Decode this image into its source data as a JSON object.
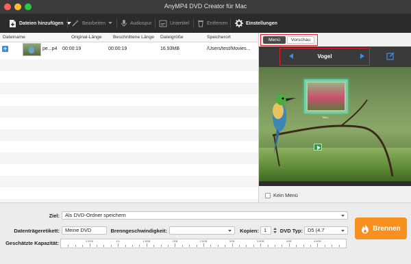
{
  "window": {
    "title": "AnyMP4 DVD Creator für Mac"
  },
  "toolbar": {
    "add_files": "Dateien hinzufügen",
    "edit": "Bearbeiten",
    "audio": "Audiospur",
    "subtitle": "Untertitel",
    "remove": "Entfernen",
    "settings": "Einstellungen"
  },
  "file_table": {
    "columns": [
      "Dateiname",
      "Original-Länge",
      "Beschnittene Länge",
      "Dateigröße",
      "Speicherort"
    ],
    "rows": [
      {
        "name": "pe...p4",
        "original": "00:00:19",
        "trimmed": "00:00:19",
        "size": "16.93MB",
        "location": "/Users/test/Movies..."
      }
    ]
  },
  "preview": {
    "tabs": [
      "Menü",
      "Vorschau"
    ],
    "active_tab": "Menü",
    "template_name": "Vogel",
    "thumb_title": "Title1",
    "no_menu_label": "Kein Menü"
  },
  "output": {
    "target_label": "Ziel:",
    "target_value": "Als DVD-Ordner speichern",
    "disc_label": "Datenträgeretikett:",
    "disc_value": "Meine DVD",
    "speed_label": "Brenngeschwindigkeit:",
    "speed_value": "",
    "copies_label": "Kopien:",
    "copies_value": "1",
    "dvd_type_label": "DVD Typ:",
    "dvd_type_value": "D5 (4.7",
    "capacity_label": "Geschätzte Kapazität:",
    "capacity_ticks": [
      "0.5GB",
      "1G",
      "1.5GB",
      "2GB",
      "2.5GB",
      "3GB",
      "3.5GB",
      "4GB",
      "4.5GB"
    ]
  },
  "burn": {
    "label": "Brennen"
  },
  "colors": {
    "accent": "#3d8de3",
    "burn": "#f7901e",
    "highlight": "#e0202a",
    "toolbar": "#2b2b2b"
  }
}
